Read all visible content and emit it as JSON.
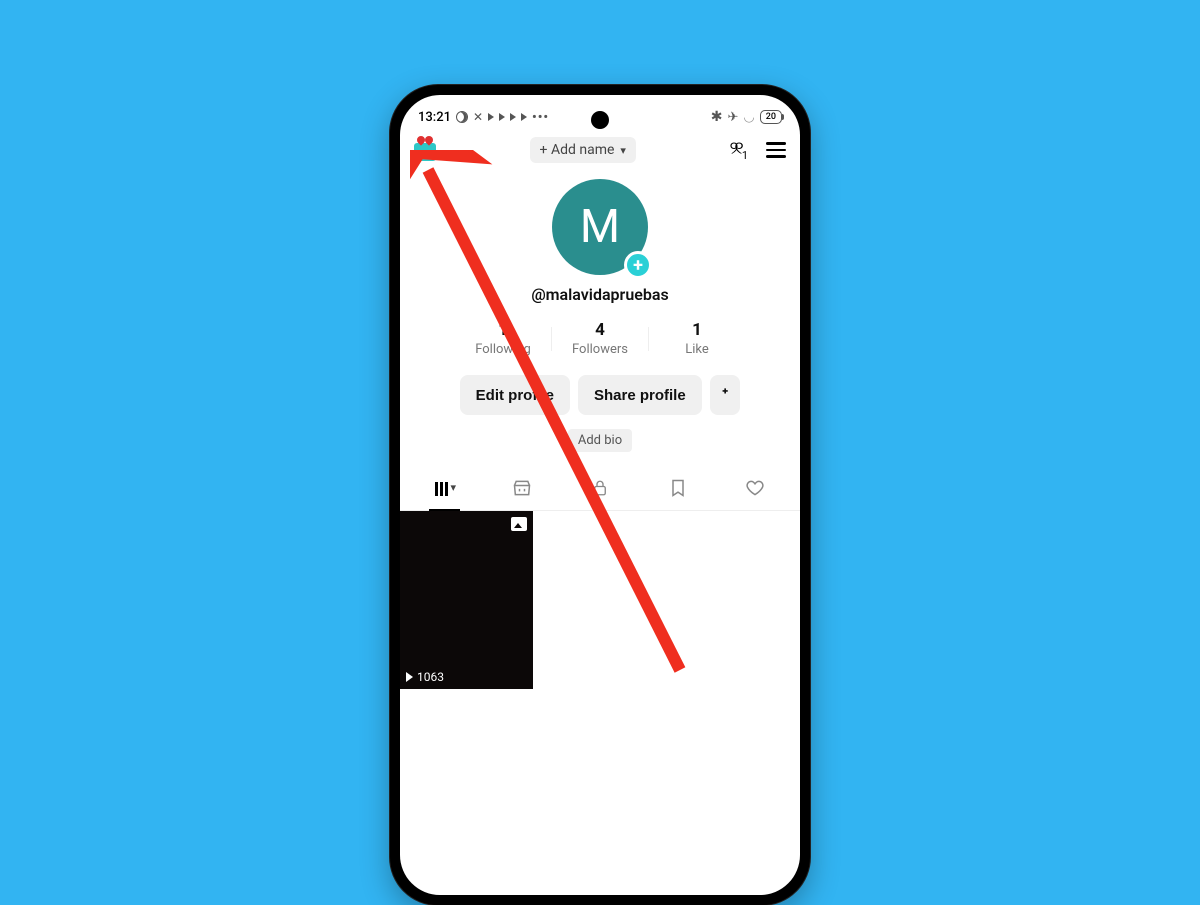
{
  "statusbar": {
    "time": "13:21",
    "battery": "20"
  },
  "header": {
    "addname": "+ Add name",
    "footcount": "1"
  },
  "profile": {
    "initial": "M",
    "handle": "@malavidapruebas"
  },
  "stats": {
    "following_n": "1",
    "following_l": "Following",
    "followers_n": "4",
    "followers_l": "Followers",
    "likes_n": "1",
    "likes_l": "Like"
  },
  "buttons": {
    "edit": "Edit profile",
    "share": "Share profile",
    "addbio": "Add bio"
  },
  "video": {
    "views": "1063"
  }
}
